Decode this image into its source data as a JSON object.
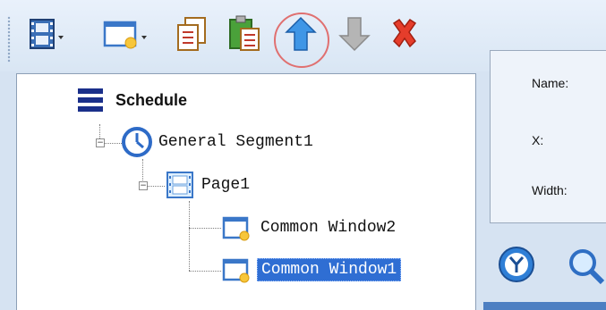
{
  "toolbar": {
    "buttons": [
      {
        "icon": "film-icon",
        "has_dropdown": true
      },
      {
        "icon": "new-window-icon",
        "has_dropdown": true
      },
      {
        "icon": "copy-icon",
        "has_dropdown": false
      },
      {
        "icon": "paste-icon",
        "has_dropdown": false
      },
      {
        "icon": "arrow-up-icon",
        "has_dropdown": false
      },
      {
        "icon": "arrow-down-icon",
        "has_dropdown": false
      },
      {
        "icon": "delete-icon",
        "has_dropdown": false
      }
    ]
  },
  "tree": {
    "root": {
      "label": "Schedule",
      "icon": "schedule-icon"
    },
    "segment": {
      "label": "General Segment1",
      "icon": "clock-icon",
      "expanded": true
    },
    "page": {
      "label": "Page1",
      "icon": "film-icon",
      "expanded": true
    },
    "windows": [
      {
        "label": "Common Window2",
        "icon": "window-icon",
        "selected": false
      },
      {
        "label": "Common Window1",
        "icon": "window-icon",
        "selected": true
      }
    ]
  },
  "properties": {
    "name_label": "Name:",
    "x_label": "X:",
    "width_label": "Width:"
  },
  "colors": {
    "selection": "#2f6ed3",
    "highlight_circle": "#e07070",
    "background": "#d6e3f2"
  }
}
